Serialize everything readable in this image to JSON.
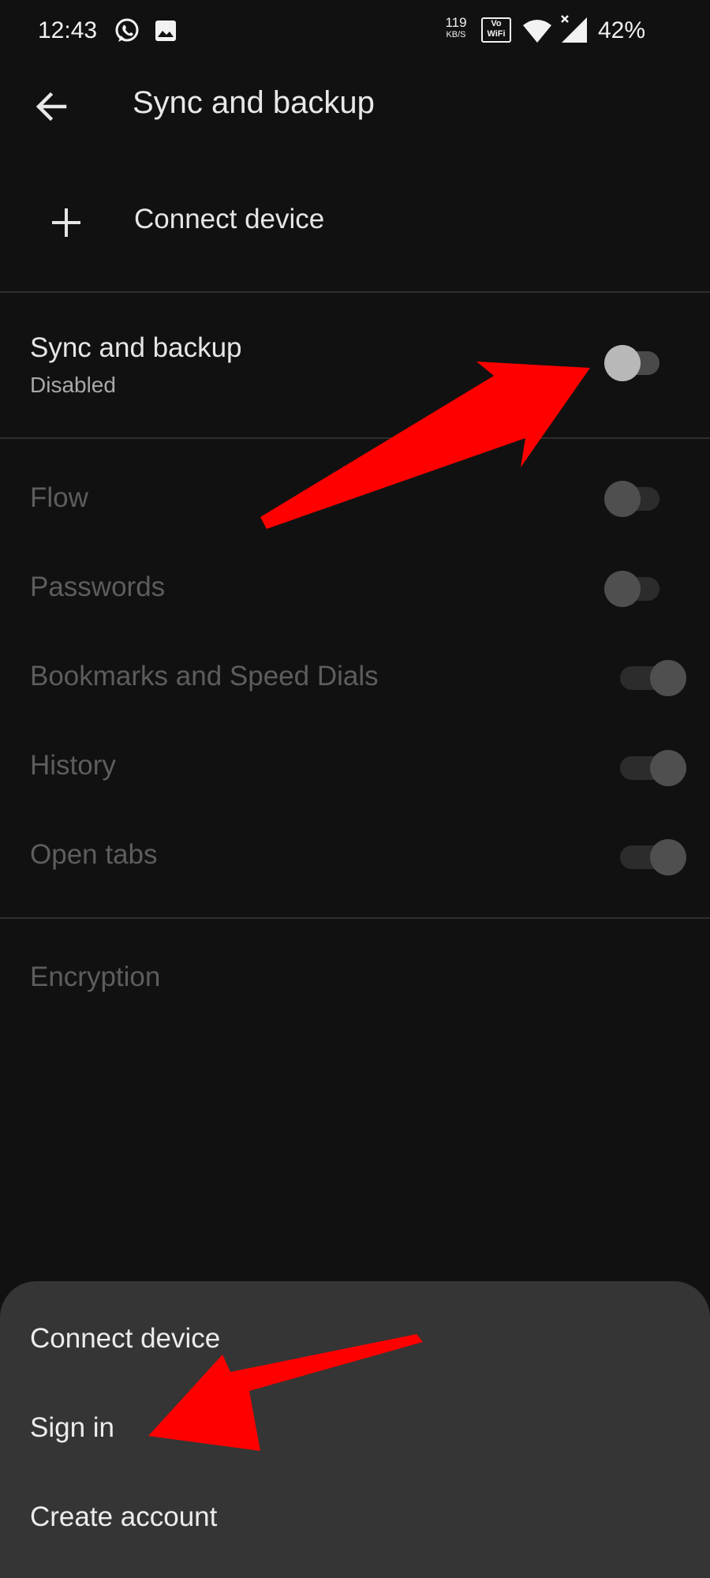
{
  "status_bar": {
    "time": "12:43",
    "net_speed_value": "119",
    "net_speed_unit": "KB/S",
    "vowifi_line1": "Vo",
    "vowifi_line2": "WiFi",
    "battery": "42%"
  },
  "header": {
    "title": "Sync and backup"
  },
  "connect_row": {
    "label": "Connect device"
  },
  "sync_setting": {
    "title": "Sync and backup",
    "subtitle": "Disabled",
    "toggle_on": false
  },
  "sync_items": [
    {
      "label": "Flow",
      "toggle_on": false
    },
    {
      "label": "Passwords",
      "toggle_on": false
    },
    {
      "label": "Bookmarks and Speed Dials",
      "toggle_on": true
    },
    {
      "label": "History",
      "toggle_on": true
    },
    {
      "label": "Open tabs",
      "toggle_on": true
    }
  ],
  "encryption": {
    "label": "Encryption"
  },
  "bottom_sheet": {
    "items": [
      {
        "label": "Connect device"
      },
      {
        "label": "Sign in"
      },
      {
        "label": "Create account"
      }
    ]
  },
  "annotation_color": "#ff0000"
}
